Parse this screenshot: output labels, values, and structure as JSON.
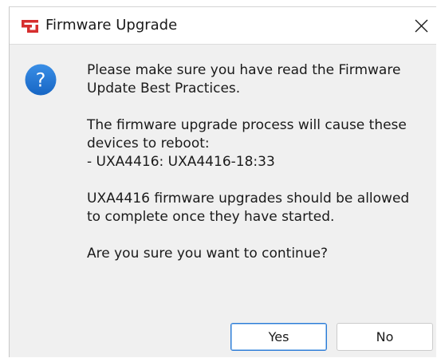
{
  "window": {
    "title": "Firmware Upgrade",
    "close_glyph": "✕",
    "app_icon": "app-logo-icon",
    "dialog_icon": "question-icon",
    "accent_color": "#1e73d4",
    "logo_color": "#d62e2e"
  },
  "message": {
    "paragraph1": [
      "Please make sure you have read the Firmware",
      "Update Best Practices."
    ],
    "paragraph2": [
      "The firmware upgrade process will cause these",
      "devices to reboot:",
      "- UXA4416: UXA4416-18:33"
    ],
    "paragraph3": [
      "UXA4416 firmware upgrades should be allowed",
      "to complete once they have started."
    ],
    "paragraph4": "Are you sure you want to continue?"
  },
  "buttons": {
    "yes": "Yes",
    "no": "No"
  }
}
